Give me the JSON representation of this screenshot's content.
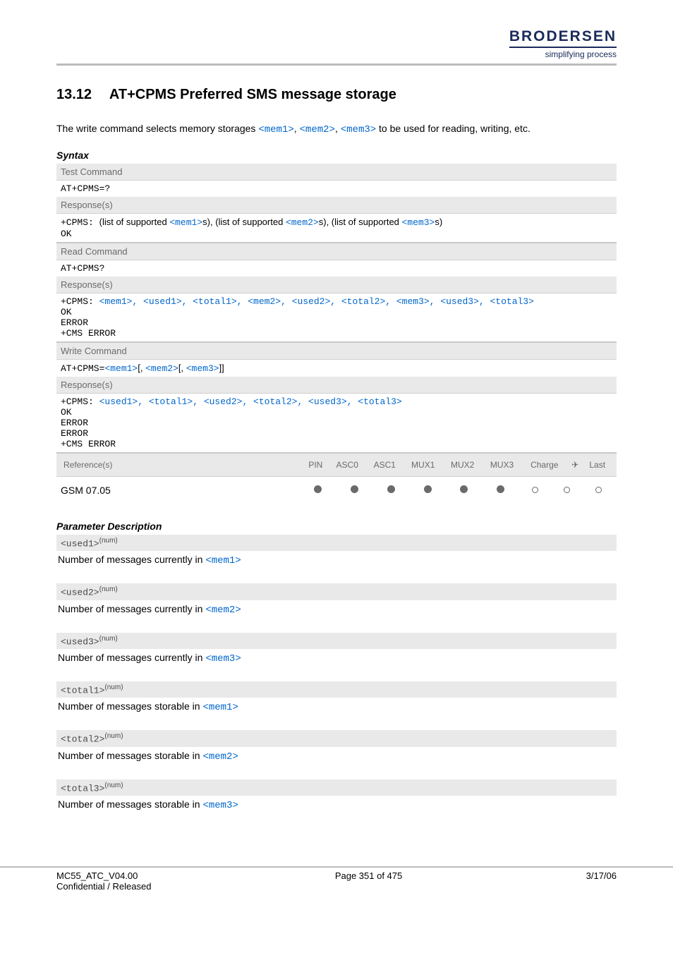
{
  "brand": {
    "name": "BRODERSEN",
    "tagline": "simplifying process"
  },
  "section": {
    "number": "13.12",
    "title": "AT+CPMS   Preferred SMS message storage"
  },
  "intro": {
    "pre": "The write command selects memory storages ",
    "m1": "<mem1>",
    "c1": ", ",
    "m2": "<mem2>",
    "c2": ", ",
    "m3": "<mem3>",
    "post": " to be used for reading, writing, etc."
  },
  "headings": {
    "syntax": "Syntax",
    "paramdesc": "Parameter Description"
  },
  "syntax": {
    "testcmd_label": "Test Command",
    "testcmd": "AT+CPMS=?",
    "responses_label": "Response(s)",
    "test_resp": {
      "prefix": "+CPMS: ",
      "p1a": "(list of supported ",
      "p1m": "<mem1>",
      "p1b": "s), ",
      "p2a": "(list of supported ",
      "p2m": "<mem2>",
      "p2b": "s), ",
      "p3a": "(list of supported ",
      "p3m": "<mem3>",
      "p3b": "s)",
      "ok": "OK"
    },
    "readcmd_label": "Read Command",
    "readcmd": "AT+CPMS?",
    "read_resp": {
      "prefix": "+CPMS: ",
      "tokens": "<mem1>, <used1>, <total1>, <mem2>, <used2>, <total2>, <mem3>, <used3>, <total3>",
      "ok": "OK",
      "err": "ERROR",
      "cms": "+CMS ERROR"
    },
    "writecmd_label": "Write Command",
    "writecmd": {
      "pre": "AT+CPMS=",
      "m1": "<mem1>",
      "b1": "[, ",
      "m2": "<mem2>",
      "b2": "[, ",
      "m3": "<mem3>",
      "b3": "]]"
    },
    "write_resp": {
      "prefix": "+CPMS: ",
      "tokens": "<used1>, <total1>, <used2>, <total2>, <used3>, <total3>",
      "ok": "OK",
      "err1": "ERROR",
      "err2": "ERROR",
      "cms": "+CMS ERROR"
    },
    "refs_label": "Reference(s)",
    "ref_cols": [
      "PIN",
      "ASC0",
      "ASC1",
      "MUX1",
      "MUX2",
      "MUX3",
      "Charge",
      "✈",
      "Last"
    ],
    "ref_name": "GSM 07.05",
    "ref_dots": [
      "filled",
      "filled",
      "filled",
      "filled",
      "filled",
      "filled",
      "empty",
      "empty",
      "empty"
    ]
  },
  "params": [
    {
      "name": "<used1>",
      "sup": "(num)",
      "desc_pre": "Number of messages currently in ",
      "desc_mem": "<mem1>"
    },
    {
      "name": "<used2>",
      "sup": "(num)",
      "desc_pre": "Number of messages currently in ",
      "desc_mem": "<mem2>"
    },
    {
      "name": "<used3>",
      "sup": "(num)",
      "desc_pre": "Number of messages currently in ",
      "desc_mem": "<mem3>"
    },
    {
      "name": "<total1>",
      "sup": "(num)",
      "desc_pre": "Number of messages storable in ",
      "desc_mem": "<mem1>"
    },
    {
      "name": "<total2>",
      "sup": "(num)",
      "desc_pre": "Number of messages storable in ",
      "desc_mem": "<mem2>"
    },
    {
      "name": "<total3>",
      "sup": "(num)",
      "desc_pre": "Number of messages storable in ",
      "desc_mem": "<mem3>"
    }
  ],
  "footer": {
    "doc": "MC55_ATC_V04.00",
    "conf": "Confidential / Released",
    "page": "Page 351 of 475",
    "date": "3/17/06"
  }
}
